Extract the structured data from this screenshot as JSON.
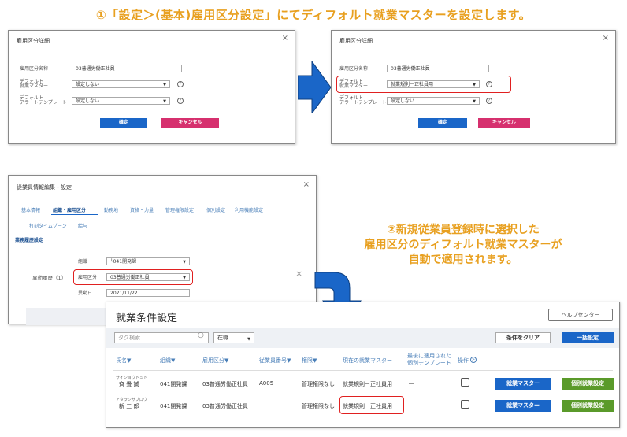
{
  "heading1": "①「設定＞(基本)雇用区分設定」にてディフォルト就業マスターを設定します。",
  "dialog_left": {
    "title": "雇用区分詳細",
    "close": "×",
    "name_label": "雇用区分名称",
    "name_value": "03普通労働正社員",
    "master_label1": "デフォルト",
    "master_label2": "就業マスター",
    "master_value": "設定しない",
    "alert_label1": "デフォルト",
    "alert_label2": "アラートテンプレート",
    "alert_value": "設定しない",
    "help": "?",
    "confirm": "確定",
    "cancel": "キャンセル"
  },
  "dialog_right": {
    "title": "雇用区分詳細",
    "close": "×",
    "name_label": "雇用区分名称",
    "name_value": "03普通労働正社員",
    "master_label1": "デフォルト",
    "master_label2": "就業マスター",
    "master_value": "就業規則－正社員用",
    "alert_label1": "デフォルト",
    "alert_label2": "アラートテンプレート",
    "alert_value": "設定しない",
    "help": "?",
    "confirm": "確定",
    "cancel": "キャンセル"
  },
  "emp_dialog": {
    "title": "従業員情報編集・設定",
    "close": "×",
    "tabs": [
      "基本情報",
      "組織・雇用区分",
      "勤務地",
      "資格・力量",
      "管理権限設定",
      "個別設定",
      "利用機能設定"
    ],
    "tabs2": [
      "打刻タイムゾーン",
      "給与"
    ],
    "section": "業務履歴設定",
    "org_label": "組織",
    "org_value": "└041開発課",
    "history_label": "異動履歴（1）",
    "emp_type_label": "雇用区分",
    "emp_type_value": "03普通労働正社員",
    "date_label": "異動日",
    "date_value": "2021/11/22",
    "close2": "×"
  },
  "note2": [
    "②新規従業員登録時に選択した",
    "雇用区分のディフォルト就業マスターが",
    "自動で適用されます。"
  ],
  "work_panel": {
    "title": "就業条件設定",
    "help_center": "ヘルプセンター",
    "search_placeholder": "タグ検索",
    "status_filter": "在職",
    "clear_btn": "条件をクリア",
    "bulk_btn": "一括設定",
    "columns": [
      "氏名▼",
      "組織▼",
      "雇用区分▼",
      "従業員番号▼",
      "権限▼",
      "現在の就業マスター",
      "最後に適用された",
      "個別テンプレート",
      "操作"
    ],
    "rows": [
      {
        "kana": "サイショウドミト",
        "name": "斉 畳 誠",
        "org": "041開発課",
        "type": "03普通労働正社員",
        "num": "A005",
        "perm": "管理権限なし",
        "master": "就業規則－正社員用",
        "tmpl": "―",
        "btn1": "就業マスター",
        "btn2": "個別就業設定"
      },
      {
        "kana": "アタラシサブロウ",
        "name": "新 三 郎",
        "org": "041開発課",
        "type": "03普通労働正社員",
        "num": "",
        "perm": "管理権限なし",
        "master": "就業規則－正社員用",
        "tmpl": "―",
        "btn1": "就業マスター",
        "btn2": "個別就業設定"
      }
    ]
  },
  "colors": {
    "accent_orange": "#e8a020",
    "blue": "#1a66c8",
    "pink": "#d6306e",
    "green": "#5a9a2a",
    "red": "#e02020"
  }
}
